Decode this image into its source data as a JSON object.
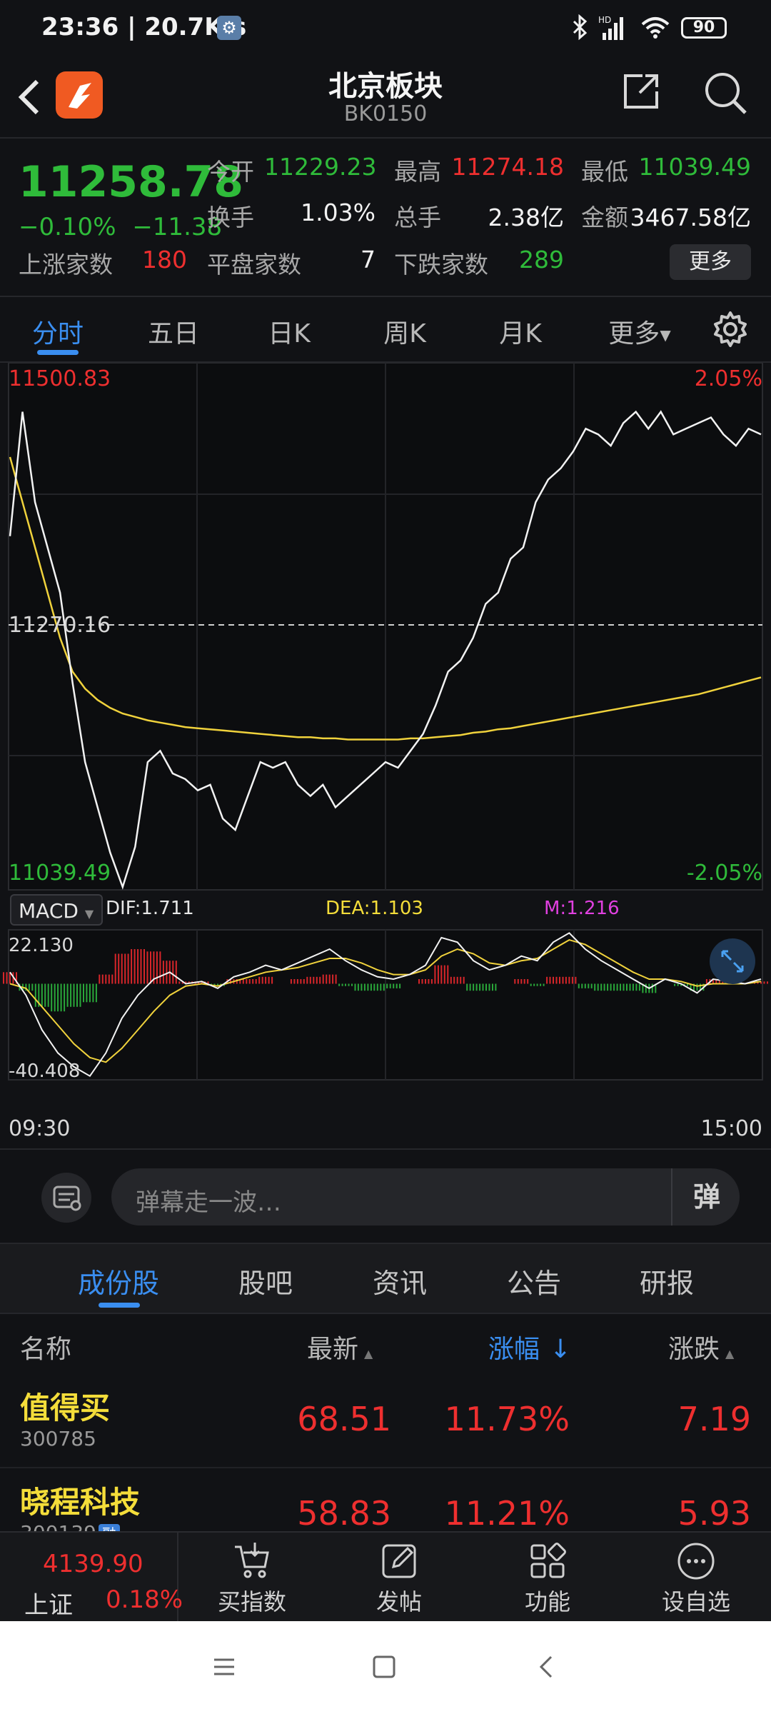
{
  "status_bar": {
    "time_speed": "23:36 | 20.7K/s",
    "network": "HD",
    "battery": "90"
  },
  "header": {
    "title": "北京板块",
    "code": "BK0150"
  },
  "quote": {
    "price": "11258.78",
    "change_pct": "−0.10%",
    "change": "−11.38",
    "open_label": "今开",
    "open": "11229.23",
    "high_label": "最高",
    "high": "11274.18",
    "low_label": "最低",
    "low": "11039.49",
    "turnover_label": "换手",
    "turnover": "1.03%",
    "volume_label": "总手",
    "volume": "2.38亿",
    "amount_label": "金额",
    "amount": "3467.58亿",
    "up_label": "上涨家数",
    "up": "180",
    "flat_label": "平盘家数",
    "flat": "7",
    "down_label": "下跌家数",
    "down": "289",
    "more_label": "更多"
  },
  "period_tabs": [
    "分时",
    "五日",
    "日K",
    "周K",
    "月K",
    "更多"
  ],
  "chart_data": {
    "type": "line",
    "price_axis": {
      "max_label": "11500.83",
      "min_label": "11039.49",
      "ref_label": "11270.16",
      "max_pct": "2.05%",
      "min_pct": "-2.05%"
    },
    "time_axis": {
      "start": "09:30",
      "end": "15:00"
    },
    "price_series": [
      11350,
      11460,
      11380,
      11340,
      11300,
      11220,
      11150,
      11110,
      11070,
      11039.49,
      11075,
      11150,
      11160,
      11140,
      11135,
      11125,
      11130,
      11100,
      11090,
      11120,
      11150,
      11145,
      11150,
      11130,
      11120,
      11130,
      11110,
      11120,
      11130,
      11140,
      11150,
      11145,
      11160,
      11175,
      11200,
      11230,
      11240,
      11260,
      11290,
      11300,
      11330,
      11340,
      11380,
      11400,
      11410,
      11425,
      11445,
      11440,
      11430,
      11450,
      11460,
      11445,
      11460,
      11440,
      11445,
      11450,
      11455,
      11440,
      11430,
      11445,
      11440
    ],
    "avg_series": [
      11420,
      11380,
      11340,
      11300,
      11260,
      11230,
      11215,
      11205,
      11198,
      11193,
      11190,
      11187,
      11185,
      11183,
      11181,
      11180,
      11179,
      11178,
      11177,
      11176,
      11175,
      11174,
      11173,
      11172,
      11172,
      11171,
      11171,
      11170,
      11170,
      11170,
      11170,
      11170,
      11171,
      11171,
      11172,
      11173,
      11174,
      11176,
      11177,
      11179,
      11180,
      11182,
      11184,
      11186,
      11188,
      11190,
      11192,
      11194,
      11196,
      11198,
      11200,
      11202,
      11204,
      11206,
      11208,
      11210,
      11213,
      11216,
      11219,
      11222,
      11225
    ],
    "macd": {
      "label": "MACD",
      "dif_label": "DIF:1.711",
      "dea_label": "DEA:1.103",
      "m_label": "M:1.216",
      "max_label": "22.130",
      "min_label": "-40.408",
      "dif": [
        5,
        -5,
        -20,
        -30,
        -36,
        -40,
        -30,
        -15,
        -5,
        2,
        5,
        0,
        1,
        -2,
        3,
        5,
        8,
        6,
        9,
        12,
        15,
        10,
        6,
        3,
        2,
        4,
        8,
        20,
        18,
        10,
        6,
        8,
        12,
        10,
        18,
        22,
        15,
        10,
        6,
        2,
        -2,
        2,
        0,
        -4,
        2,
        1,
        0,
        2
      ],
      "dea": [
        0,
        -2,
        -10,
        -18,
        -26,
        -32,
        -34,
        -28,
        -20,
        -12,
        -5,
        -1,
        0,
        -1,
        1,
        3,
        5,
        6,
        7,
        9,
        11,
        11,
        9,
        6,
        4,
        4,
        6,
        12,
        15,
        13,
        9,
        8,
        10,
        11,
        15,
        19,
        17,
        13,
        9,
        5,
        2,
        2,
        1,
        -1,
        0,
        0,
        0,
        1
      ],
      "hist": [
        5,
        -3,
        -10,
        -12,
        -10,
        -8,
        4,
        13,
        15,
        14,
        10,
        1,
        1,
        -1,
        2,
        2,
        3,
        0,
        2,
        3,
        4,
        -1,
        -3,
        -3,
        -2,
        0,
        2,
        8,
        3,
        -3,
        -3,
        0,
        2,
        -1,
        3,
        3,
        -2,
        -3,
        -3,
        -3,
        -4,
        0,
        -1,
        -3,
        2,
        1,
        0,
        1
      ]
    }
  },
  "danmu": {
    "placeholder": "弹幕走一波…",
    "send_label": "弹"
  },
  "content_tabs": [
    "成份股",
    "股吧",
    "资讯",
    "公告",
    "研报"
  ],
  "table": {
    "headers": {
      "name": "名称",
      "latest": "最新",
      "pct": "涨幅",
      "chg": "涨跌"
    },
    "rows": [
      {
        "name": "值得买",
        "code": "300785",
        "latest": "68.51",
        "pct": "11.73%",
        "chg": "7.19"
      },
      {
        "name": "晓程科技",
        "code": "300139",
        "latest": "58.83",
        "pct": "11.21%",
        "chg": "5.93"
      }
    ]
  },
  "bottom_bar": {
    "index_value": "4139.90",
    "index_name": "上证",
    "index_pct": "0.18%",
    "items": [
      "买指数",
      "发帖",
      "功能",
      "设自选"
    ]
  }
}
